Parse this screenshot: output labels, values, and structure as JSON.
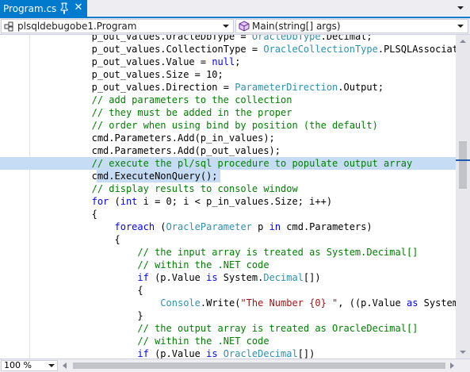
{
  "tab": {
    "title": "Program.cs",
    "pin_icon": "pin-icon",
    "close_glyph": "✕"
  },
  "nav": {
    "class_combo": "plsqldebugobe1.Program",
    "member_combo": "Main(string[] args)"
  },
  "zoom": {
    "value": "100 %"
  },
  "colors": {
    "accent": "#007acc",
    "keyword": "#0000ff",
    "type": "#2b91af",
    "comment": "#008000",
    "string": "#a31515",
    "selection": "#c6dcf5"
  },
  "code_lines": [
    {
      "indent": "            ",
      "parts": [
        [
          "p_out_values.OracleDbType = ",
          ""
        ],
        [
          "OracleDbType",
          "ty"
        ],
        [
          ".Decimal;",
          ""
        ]
      ]
    },
    {
      "indent": "            ",
      "parts": [
        [
          "p_out_values.CollectionType = ",
          ""
        ],
        [
          "OracleCollectionType",
          "ty"
        ],
        [
          ".PLSQLAssociativeArray;",
          ""
        ]
      ]
    },
    {
      "indent": "            ",
      "parts": [
        [
          "p_out_values.Value = ",
          ""
        ],
        [
          "null",
          "kw"
        ],
        [
          ";",
          ""
        ]
      ]
    },
    {
      "indent": "            ",
      "parts": [
        [
          "p_out_values.Size = 10;",
          ""
        ]
      ]
    },
    {
      "indent": "            ",
      "parts": [
        [
          "p_out_values.Direction = ",
          ""
        ],
        [
          "ParameterDirection",
          "ty"
        ],
        [
          ".Output;",
          ""
        ]
      ]
    },
    {
      "indent": "            ",
      "parts": [
        [
          "// add parameters to the collection",
          "cm"
        ]
      ]
    },
    {
      "indent": "            ",
      "parts": [
        [
          "// they must be added in the proper",
          "cm"
        ]
      ]
    },
    {
      "indent": "            ",
      "parts": [
        [
          "// order when using bind by position (the default)",
          "cm"
        ]
      ]
    },
    {
      "indent": "            ",
      "parts": [
        [
          "cmd.Parameters.Add(p_in_values);",
          ""
        ]
      ]
    },
    {
      "indent": "            ",
      "parts": [
        [
          "cmd.Parameters.Add(p_out_values);",
          ""
        ]
      ]
    },
    {
      "indent": "            ",
      "parts": [
        [
          "// execute the pl/sql procedure to populate output array",
          "cm"
        ]
      ],
      "highlight": "full"
    },
    {
      "indent": "            ",
      "parts": [
        [
          "cmd.ExecuteNonQuery();",
          ""
        ]
      ],
      "highlight": "partial"
    },
    {
      "indent": "            ",
      "parts": [
        [
          "// display results to console window",
          "cm"
        ]
      ]
    },
    {
      "indent": "            ",
      "parts": [
        [
          "for",
          "kw"
        ],
        [
          " (",
          ""
        ],
        [
          "int",
          "kw"
        ],
        [
          " i = 0; i < p_in_values.Size; i++)",
          ""
        ]
      ]
    },
    {
      "indent": "            ",
      "parts": [
        [
          "{",
          ""
        ]
      ]
    },
    {
      "indent": "                ",
      "parts": [
        [
          "foreach",
          "kw"
        ],
        [
          " (",
          ""
        ],
        [
          "OracleParameter",
          "ty"
        ],
        [
          " p ",
          ""
        ],
        [
          "in",
          "kw"
        ],
        [
          " cmd.Parameters)",
          ""
        ]
      ]
    },
    {
      "indent": "                ",
      "parts": [
        [
          "{",
          ""
        ]
      ]
    },
    {
      "indent": "                    ",
      "parts": [
        [
          "// the input array is treated as System.Decimal[]",
          "cm"
        ]
      ]
    },
    {
      "indent": "                    ",
      "parts": [
        [
          "// within the .NET code",
          "cm"
        ]
      ]
    },
    {
      "indent": "                    ",
      "parts": [
        [
          "if",
          "kw"
        ],
        [
          " (p.Value ",
          ""
        ],
        [
          "is",
          "kw"
        ],
        [
          " System.",
          ""
        ],
        [
          "Decimal",
          "ty"
        ],
        [
          "[])",
          ""
        ]
      ]
    },
    {
      "indent": "                    ",
      "parts": [
        [
          "{",
          ""
        ]
      ]
    },
    {
      "indent": "                        ",
      "parts": [
        [
          "Console",
          "ty"
        ],
        [
          ".Write(",
          ""
        ],
        [
          "\"The Number {0} \"",
          "st"
        ],
        [
          ", ((p.Value ",
          ""
        ],
        [
          "as",
          "kw"
        ],
        [
          " System.",
          ""
        ]
      ]
    },
    {
      "indent": "                    ",
      "parts": [
        [
          "}",
          ""
        ]
      ]
    },
    {
      "indent": "                    ",
      "parts": [
        [
          "// the output array is treated as OracleDecimal[]",
          "cm"
        ]
      ]
    },
    {
      "indent": "                    ",
      "parts": [
        [
          "// within the .NET code",
          "cm"
        ]
      ]
    },
    {
      "indent": "                    ",
      "parts": [
        [
          "if",
          "kw"
        ],
        [
          " (p.Value ",
          ""
        ],
        [
          "is",
          "kw"
        ],
        [
          " ",
          ""
        ],
        [
          "OracleDecimal",
          "ty"
        ],
        [
          "[])",
          ""
        ]
      ]
    }
  ]
}
